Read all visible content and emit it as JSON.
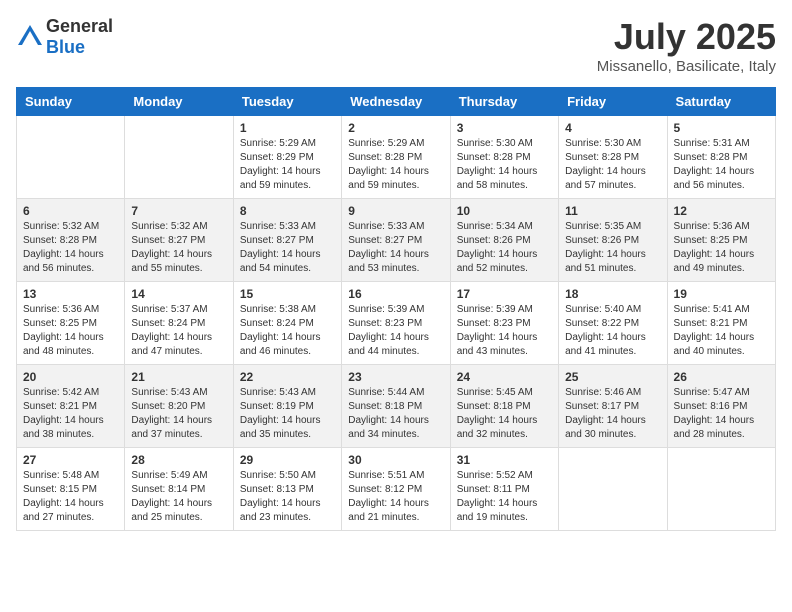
{
  "header": {
    "logo_general": "General",
    "logo_blue": "Blue",
    "month_year": "July 2025",
    "location": "Missanello, Basilicate, Italy"
  },
  "days_of_week": [
    "Sunday",
    "Monday",
    "Tuesday",
    "Wednesday",
    "Thursday",
    "Friday",
    "Saturday"
  ],
  "weeks": [
    [
      {
        "day": "",
        "info": ""
      },
      {
        "day": "",
        "info": ""
      },
      {
        "day": "1",
        "info": "Sunrise: 5:29 AM\nSunset: 8:29 PM\nDaylight: 14 hours and 59 minutes."
      },
      {
        "day": "2",
        "info": "Sunrise: 5:29 AM\nSunset: 8:28 PM\nDaylight: 14 hours and 59 minutes."
      },
      {
        "day": "3",
        "info": "Sunrise: 5:30 AM\nSunset: 8:28 PM\nDaylight: 14 hours and 58 minutes."
      },
      {
        "day": "4",
        "info": "Sunrise: 5:30 AM\nSunset: 8:28 PM\nDaylight: 14 hours and 57 minutes."
      },
      {
        "day": "5",
        "info": "Sunrise: 5:31 AM\nSunset: 8:28 PM\nDaylight: 14 hours and 56 minutes."
      }
    ],
    [
      {
        "day": "6",
        "info": "Sunrise: 5:32 AM\nSunset: 8:28 PM\nDaylight: 14 hours and 56 minutes."
      },
      {
        "day": "7",
        "info": "Sunrise: 5:32 AM\nSunset: 8:27 PM\nDaylight: 14 hours and 55 minutes."
      },
      {
        "day": "8",
        "info": "Sunrise: 5:33 AM\nSunset: 8:27 PM\nDaylight: 14 hours and 54 minutes."
      },
      {
        "day": "9",
        "info": "Sunrise: 5:33 AM\nSunset: 8:27 PM\nDaylight: 14 hours and 53 minutes."
      },
      {
        "day": "10",
        "info": "Sunrise: 5:34 AM\nSunset: 8:26 PM\nDaylight: 14 hours and 52 minutes."
      },
      {
        "day": "11",
        "info": "Sunrise: 5:35 AM\nSunset: 8:26 PM\nDaylight: 14 hours and 51 minutes."
      },
      {
        "day": "12",
        "info": "Sunrise: 5:36 AM\nSunset: 8:25 PM\nDaylight: 14 hours and 49 minutes."
      }
    ],
    [
      {
        "day": "13",
        "info": "Sunrise: 5:36 AM\nSunset: 8:25 PM\nDaylight: 14 hours and 48 minutes."
      },
      {
        "day": "14",
        "info": "Sunrise: 5:37 AM\nSunset: 8:24 PM\nDaylight: 14 hours and 47 minutes."
      },
      {
        "day": "15",
        "info": "Sunrise: 5:38 AM\nSunset: 8:24 PM\nDaylight: 14 hours and 46 minutes."
      },
      {
        "day": "16",
        "info": "Sunrise: 5:39 AM\nSunset: 8:23 PM\nDaylight: 14 hours and 44 minutes."
      },
      {
        "day": "17",
        "info": "Sunrise: 5:39 AM\nSunset: 8:23 PM\nDaylight: 14 hours and 43 minutes."
      },
      {
        "day": "18",
        "info": "Sunrise: 5:40 AM\nSunset: 8:22 PM\nDaylight: 14 hours and 41 minutes."
      },
      {
        "day": "19",
        "info": "Sunrise: 5:41 AM\nSunset: 8:21 PM\nDaylight: 14 hours and 40 minutes."
      }
    ],
    [
      {
        "day": "20",
        "info": "Sunrise: 5:42 AM\nSunset: 8:21 PM\nDaylight: 14 hours and 38 minutes."
      },
      {
        "day": "21",
        "info": "Sunrise: 5:43 AM\nSunset: 8:20 PM\nDaylight: 14 hours and 37 minutes."
      },
      {
        "day": "22",
        "info": "Sunrise: 5:43 AM\nSunset: 8:19 PM\nDaylight: 14 hours and 35 minutes."
      },
      {
        "day": "23",
        "info": "Sunrise: 5:44 AM\nSunset: 8:18 PM\nDaylight: 14 hours and 34 minutes."
      },
      {
        "day": "24",
        "info": "Sunrise: 5:45 AM\nSunset: 8:18 PM\nDaylight: 14 hours and 32 minutes."
      },
      {
        "day": "25",
        "info": "Sunrise: 5:46 AM\nSunset: 8:17 PM\nDaylight: 14 hours and 30 minutes."
      },
      {
        "day": "26",
        "info": "Sunrise: 5:47 AM\nSunset: 8:16 PM\nDaylight: 14 hours and 28 minutes."
      }
    ],
    [
      {
        "day": "27",
        "info": "Sunrise: 5:48 AM\nSunset: 8:15 PM\nDaylight: 14 hours and 27 minutes."
      },
      {
        "day": "28",
        "info": "Sunrise: 5:49 AM\nSunset: 8:14 PM\nDaylight: 14 hours and 25 minutes."
      },
      {
        "day": "29",
        "info": "Sunrise: 5:50 AM\nSunset: 8:13 PM\nDaylight: 14 hours and 23 minutes."
      },
      {
        "day": "30",
        "info": "Sunrise: 5:51 AM\nSunset: 8:12 PM\nDaylight: 14 hours and 21 minutes."
      },
      {
        "day": "31",
        "info": "Sunrise: 5:52 AM\nSunset: 8:11 PM\nDaylight: 14 hours and 19 minutes."
      },
      {
        "day": "",
        "info": ""
      },
      {
        "day": "",
        "info": ""
      }
    ]
  ]
}
